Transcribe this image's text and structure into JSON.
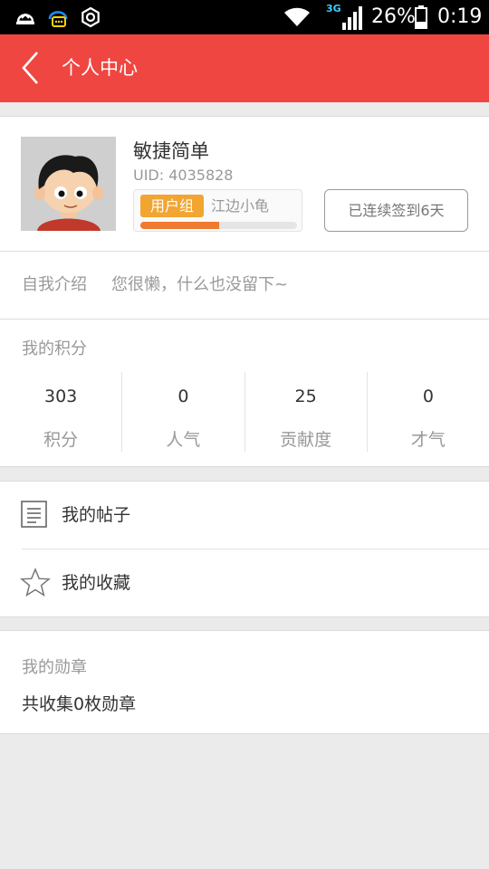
{
  "status_bar": {
    "network": "3G",
    "battery": "26%",
    "time": "0:19",
    "icons": [
      "notification-icon",
      "chat-icon",
      "settings-icon",
      "wifi-icon",
      "signal-icon",
      "battery-icon"
    ]
  },
  "header": {
    "title": "个人中心",
    "back_icon": "back-arrow-icon"
  },
  "profile": {
    "nickname": "敏捷简单",
    "uid": "UID: 4035828",
    "group_badge": "用户组",
    "group_name": "江边小龟",
    "level_progress": 0.5,
    "signin_label": "已连续签到6天"
  },
  "intro": {
    "label": "自我介绍",
    "text": "您很懒，什么也没留下~"
  },
  "points": {
    "title": "我的积分",
    "items": [
      {
        "value": "303",
        "label": "积分"
      },
      {
        "value": "0",
        "label": "人气"
      },
      {
        "value": "25",
        "label": "贡献度"
      },
      {
        "value": "0",
        "label": "才气"
      }
    ]
  },
  "menu": [
    {
      "label": "我的帖子",
      "icon": "document-icon"
    },
    {
      "label": "我的收藏",
      "icon": "star-icon"
    }
  ],
  "medals": {
    "title": "我的勋章",
    "summary": "共收集0枚勋章"
  },
  "colors": {
    "accent": "#f04641",
    "badge": "#f2a531",
    "progress": "#f07a30"
  }
}
